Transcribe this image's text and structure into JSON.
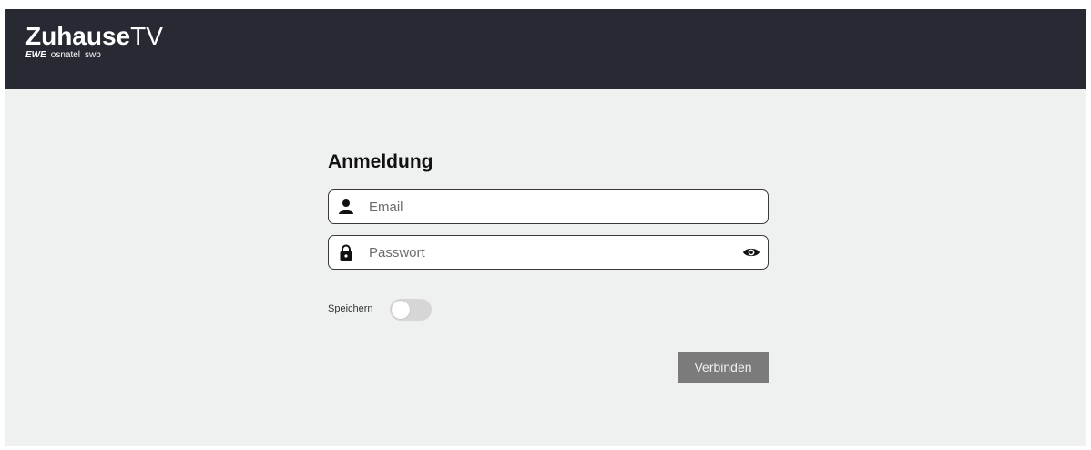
{
  "header": {
    "brand_bold": "Zuhause",
    "brand_light": "TV",
    "partners": [
      "EWE",
      "osnatel",
      "swb"
    ],
    "background_color": "#272a33"
  },
  "login": {
    "title": "Anmeldung",
    "email": {
      "placeholder": "Email",
      "value": "",
      "icon": "user-icon"
    },
    "password": {
      "placeholder": "Passwort",
      "value": "",
      "icon": "lock-icon",
      "toggle_icon": "eye-icon"
    },
    "remember": {
      "label": "Speichern",
      "checked": false
    },
    "submit_label": "Verbinden"
  },
  "colors": {
    "page_background": "#eef1f0",
    "button_background": "#7b7b7b",
    "toggle_off": "#d6d6d6"
  }
}
